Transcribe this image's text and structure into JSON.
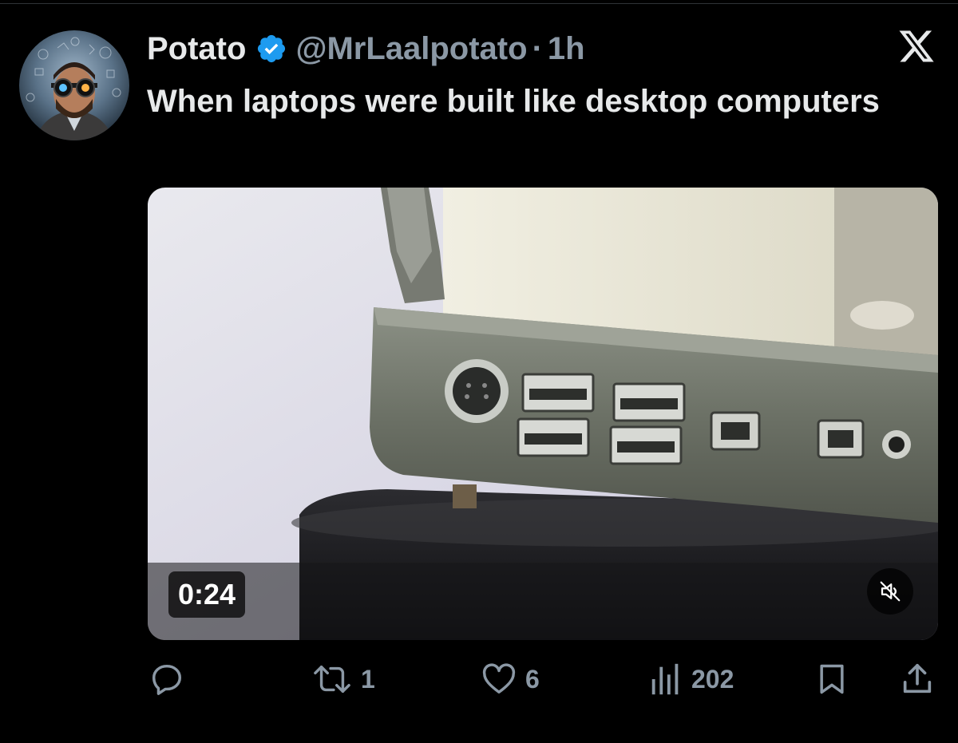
{
  "post": {
    "display_name": "Potato",
    "handle": "@MrLaalpotato",
    "separator": "·",
    "time": "1h",
    "text": "When laptops were built like desktop computers"
  },
  "video": {
    "duration": "0:24",
    "muted": true
  },
  "actions": {
    "replies": "",
    "reposts": "1",
    "likes": "6",
    "views": "202"
  },
  "icons": {
    "verified": "verified-badge-icon",
    "brand": "x-logo-icon",
    "reply": "reply-icon",
    "repost": "repost-icon",
    "like": "heart-icon",
    "views": "views-chart-icon",
    "bookmark": "bookmark-icon",
    "share": "share-icon",
    "mute": "muted-speaker-icon"
  },
  "colors": {
    "background": "#000000",
    "text": "#e7e9ea",
    "secondary": "#8b98a5",
    "verified": "#1d9bf0"
  }
}
